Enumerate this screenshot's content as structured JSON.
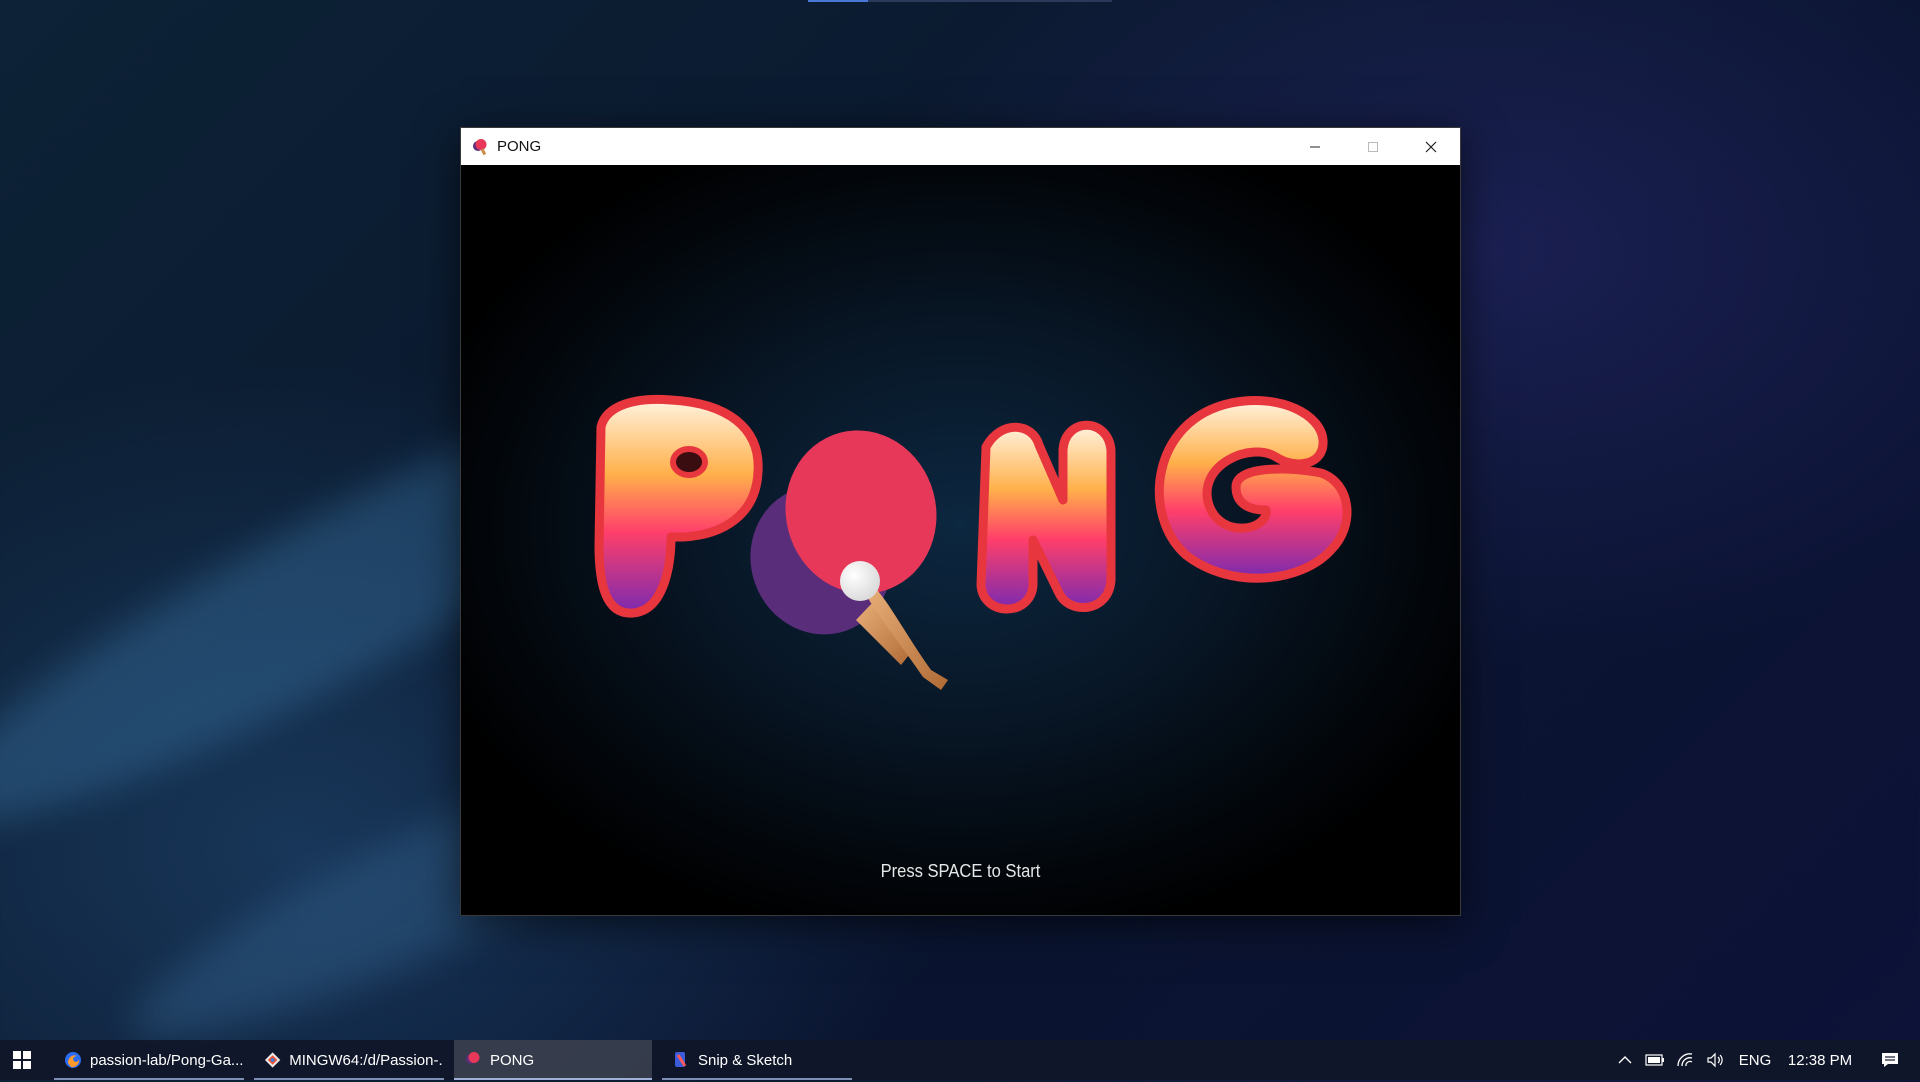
{
  "window": {
    "title": "PONG",
    "icon": "pong-paddle-icon",
    "controls": [
      "minimize-icon",
      "maximize-icon",
      "close-icon"
    ]
  },
  "game": {
    "logo_text": "PONG",
    "prompt": "Press SPACE to Start"
  },
  "taskbar": {
    "start_icon": "windows-start-icon",
    "apps": [
      {
        "label": "passion-lab/Pong-Ga...",
        "icon": "firefox-icon",
        "active": false
      },
      {
        "label": "MINGW64:/d/Passion-...",
        "icon": "git-bash-icon",
        "active": false
      },
      {
        "label": "PONG",
        "icon": "pong-paddle-icon",
        "active": true
      },
      {
        "label": "Snip & Sketch",
        "icon": "snip-sketch-icon",
        "active": false
      }
    ],
    "tray": {
      "language": "ENG",
      "time": "12:38 PM",
      "icons": [
        "chevron-up-icon",
        "battery-icon",
        "wifi-icon",
        "volume-icon",
        "notification-icon"
      ]
    }
  },
  "colors": {
    "logo_top": "#fff3df",
    "logo_mid": "#ff9a3c",
    "logo_low": "#ff2f6e",
    "logo_bottom": "#7a2ab0",
    "logo_outline": "#e8363e",
    "paddle_red": "#e8385a",
    "paddle_purple": "#5a2d7a",
    "taskbar_bg": "#101628"
  }
}
